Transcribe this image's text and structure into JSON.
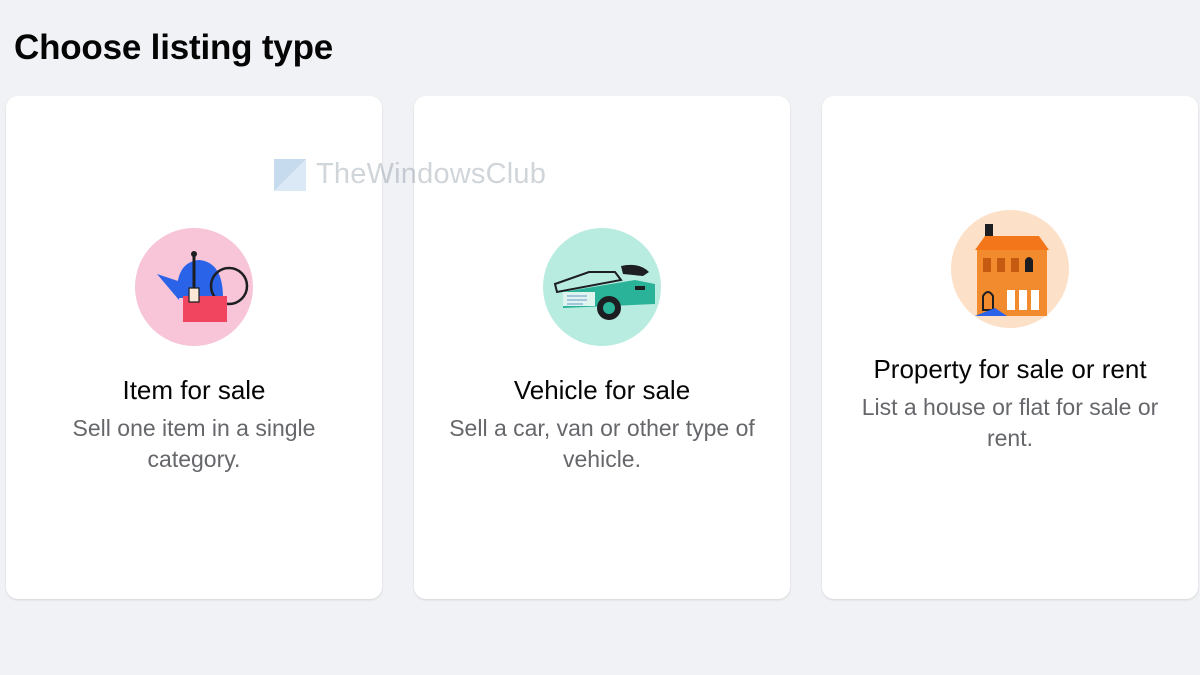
{
  "header": {
    "title": "Choose listing type"
  },
  "watermark": {
    "text": "TheWindowsClub"
  },
  "cards": [
    {
      "title": "Item for sale",
      "description": "Sell one item in a single category.",
      "icon": "kettle-with-price-tag-icon",
      "circle_color": "#f7c4d8"
    },
    {
      "title": "Vehicle for sale",
      "description": "Sell a car, van or other type of vehicle.",
      "icon": "car-icon",
      "circle_color": "#b9ece0"
    },
    {
      "title": "Property for sale or rent",
      "description": "List a house or flat for sale or rent.",
      "icon": "house-icon",
      "circle_color": "#fde0c8"
    }
  ],
  "colors": {
    "background": "#f0f2f5",
    "card": "#ffffff",
    "title_text": "#050505",
    "description_text": "#65676b"
  }
}
